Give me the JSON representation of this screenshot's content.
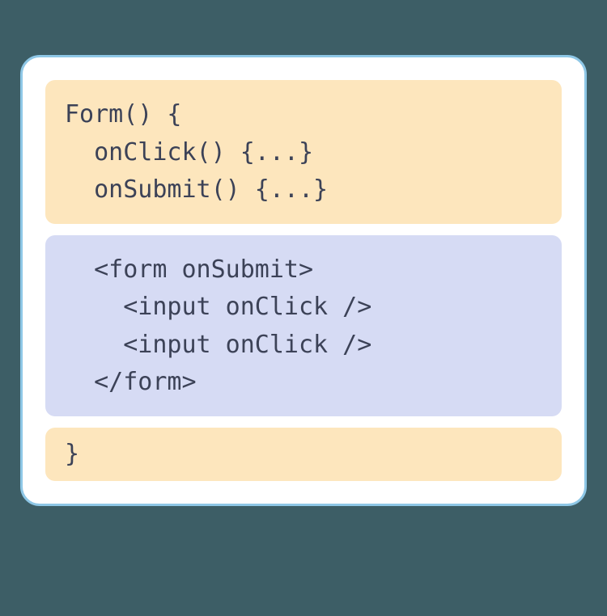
{
  "colors": {
    "page_bg": "#3d5e66",
    "card_bg": "#ffffff",
    "card_border": "#8ec7e6",
    "js_block_bg": "#fde6bd",
    "jsx_block_bg": "#d6dbf4",
    "text": "#3c4257"
  },
  "code": {
    "js_header": "Form() {\n  onClick() {...}\n  onSubmit() {...}",
    "jsx_body": "  <form onSubmit>\n    <input onClick />\n    <input onClick />\n  </form>",
    "js_footer": "}"
  }
}
